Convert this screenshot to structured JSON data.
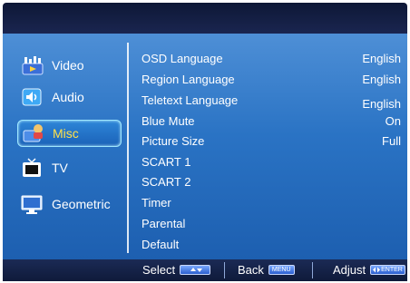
{
  "sidebar": {
    "items": [
      {
        "label": "Video"
      },
      {
        "label": "Audio"
      },
      {
        "label": "Misc"
      },
      {
        "label": "TV"
      },
      {
        "label": "Geometric"
      }
    ]
  },
  "menu": {
    "rows": [
      {
        "label": "OSD Language",
        "value": "English"
      },
      {
        "label": "Region Language",
        "value": "English"
      },
      {
        "label": "Teletext Language",
        "value": "English"
      },
      {
        "label": "Blue Mute",
        "value": "On"
      },
      {
        "label": "Picture Size",
        "value": "Full"
      },
      {
        "label": "SCART 1",
        "value": ""
      },
      {
        "label": "SCART 2",
        "value": ""
      },
      {
        "label": "Timer",
        "value": ""
      },
      {
        "label": "Parental",
        "value": ""
      },
      {
        "label": "Default",
        "value": ""
      }
    ]
  },
  "footer": {
    "select_label": "Select",
    "back_label": "Back",
    "back_key": "MENU",
    "adjust_label": "Adjust",
    "adjust_key": "ENTER"
  },
  "colors": {
    "panel": "#2a73c4",
    "selected_text": "#ffe14a",
    "footer_bg": "#0f1a3a"
  }
}
